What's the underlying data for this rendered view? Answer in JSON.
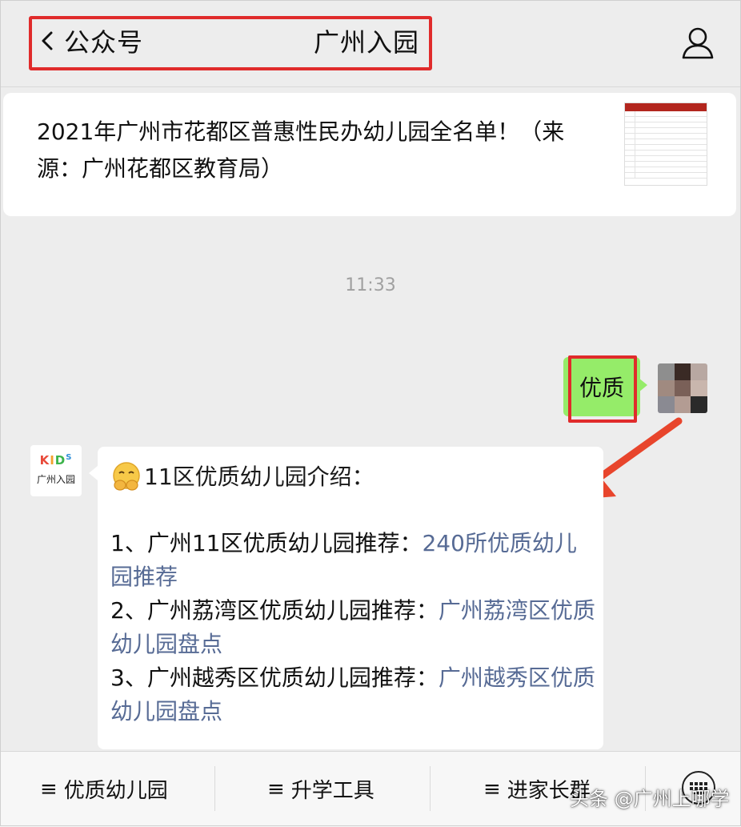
{
  "header": {
    "back_label": "公众号",
    "title": "广州入园"
  },
  "article": {
    "title": "2021年广州市花都区普惠性民办幼儿园全名单！（来源：广州花都区教育局）"
  },
  "chat": {
    "time": "11:33",
    "outgoing_message": "优质",
    "kids_logo": "KIDS",
    "kids_name": "广州入园",
    "incoming_heading": "11区优质幼儿园介绍：",
    "items": [
      {
        "prefix": "1、广州11区优质幼儿园推荐：",
        "link": "240所优质幼儿园推荐"
      },
      {
        "prefix": "2、广州荔湾区优质幼儿园推荐：",
        "link": "广州荔湾区优质幼儿园盘点"
      },
      {
        "prefix": "3、广州越秀区优质幼儿园推荐：",
        "link": "广州越秀区优质幼儿园盘点"
      }
    ]
  },
  "menu": {
    "items": [
      "优质幼儿园",
      "升学工具",
      "进家长群"
    ]
  },
  "watermark": "头条 @广州上哪学",
  "colors": {
    "highlight": "#e02b2b",
    "outgoing_bubble": "#95ec69",
    "link": "#576b95",
    "background": "#ededed"
  }
}
